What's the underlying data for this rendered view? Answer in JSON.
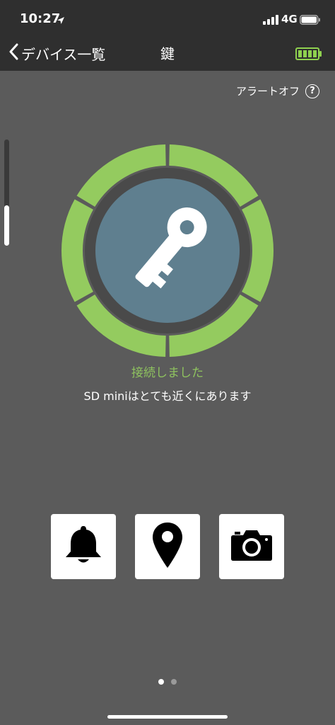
{
  "status_bar": {
    "time": "10:27",
    "network": "4G",
    "icons": [
      "location-arrow-icon",
      "cellular-signal-icon",
      "battery-icon"
    ]
  },
  "nav": {
    "back_label": "デバイス一覧",
    "title": "鍵",
    "device_battery_level": 1.0,
    "device_battery_color": "#8fd14f"
  },
  "alert": {
    "label": "アラートオフ",
    "help_glyph": "?"
  },
  "scroll_indicator": {
    "level": 0.38
  },
  "gauge": {
    "ring_color": "#94cb5f",
    "center_color": "#5f7f8f",
    "gap_color": "#4a4a4a",
    "segments": 6,
    "icon": "key-icon"
  },
  "connection": {
    "status": "接続しました",
    "status_color": "#8fc35f",
    "proximity": "SD miniはとても近くにあります"
  },
  "actions": [
    {
      "icon": "bell-icon"
    },
    {
      "icon": "map-pin-icon"
    },
    {
      "icon": "camera-icon"
    }
  ],
  "pager": {
    "pages": 2,
    "current": 1
  }
}
